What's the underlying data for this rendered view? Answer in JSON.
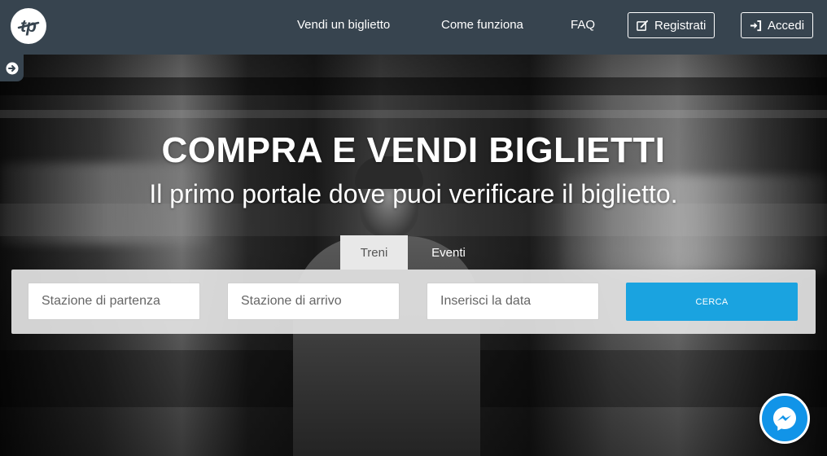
{
  "nav": {
    "links": [
      {
        "label": "Vendi un biglietto"
      },
      {
        "label": "Come funziona"
      },
      {
        "label": "FAQ"
      }
    ],
    "register_label": "Registrati",
    "login_label": "Accedi"
  },
  "hero": {
    "title": "COMPRA E VENDI BIGLIETTI",
    "subtitle": "Il primo portale dove puoi verificare il biglietto."
  },
  "tabs": [
    {
      "label": "Treni",
      "active": true
    },
    {
      "label": "Eventi",
      "active": false
    }
  ],
  "search": {
    "departure_placeholder": "Stazione di partenza",
    "arrival_placeholder": "Stazione di arrivo",
    "date_placeholder": "Inserisci la data",
    "button_label": "CERCA"
  },
  "colors": {
    "navbar": "#37444f",
    "accent": "#1aa3e0",
    "messenger": "#1194e8"
  },
  "icons": {
    "logo": "tp-logo",
    "register": "edit-icon",
    "login": "sign-in-icon",
    "sidebar": "arrow-circle-right-icon",
    "chat": "messenger-icon"
  }
}
